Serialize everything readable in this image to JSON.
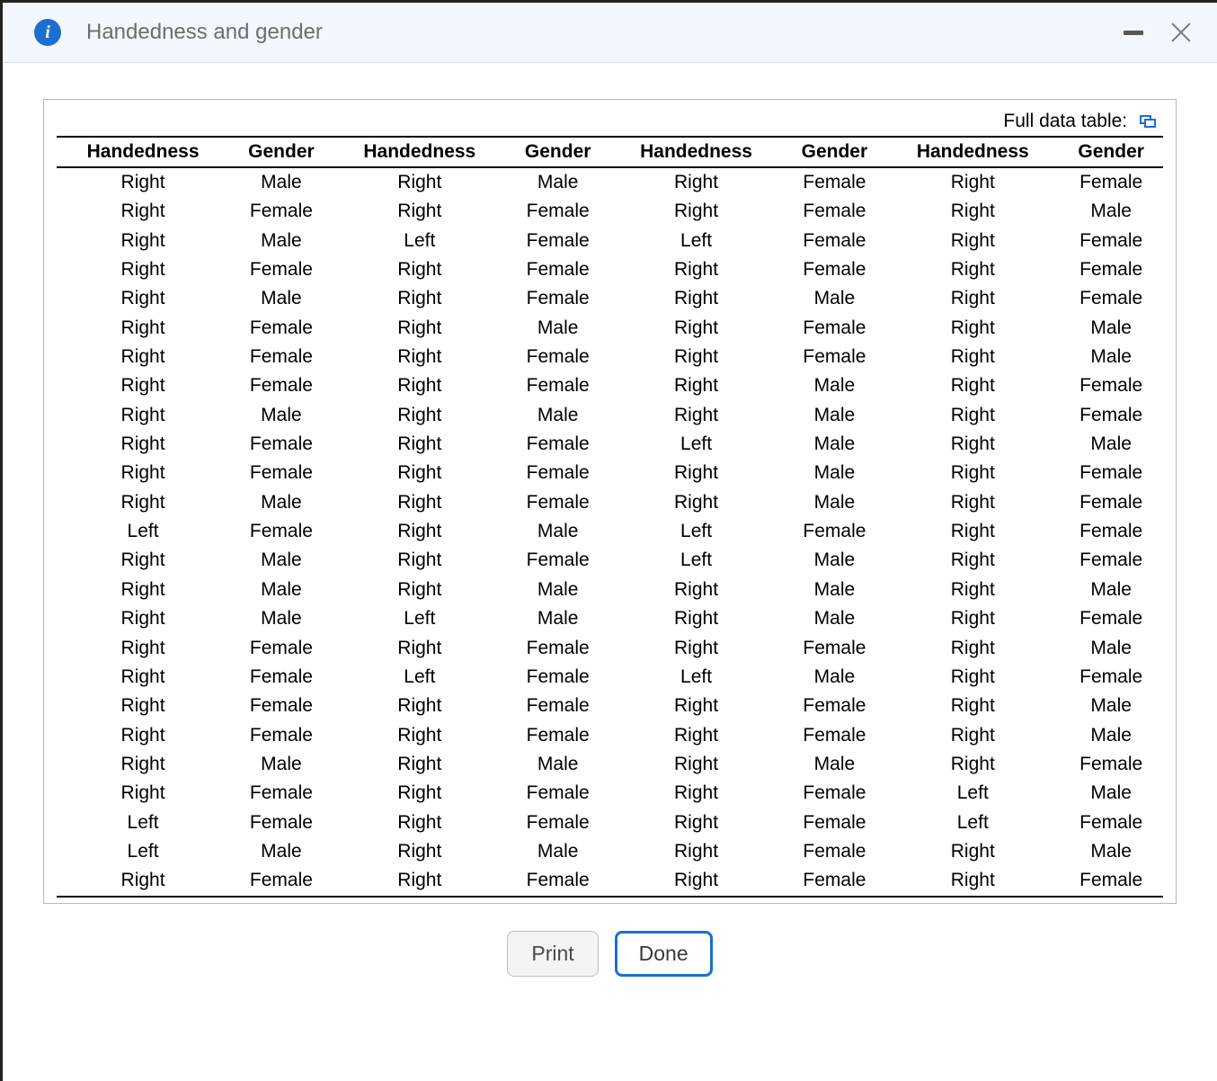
{
  "header": {
    "title": "Handedness and gender"
  },
  "caption_label": "Full data table:",
  "columns": [
    "Handedness",
    "Gender",
    "Handedness",
    "Gender",
    "Handedness",
    "Gender",
    "Handedness",
    "Gender"
  ],
  "rows": [
    [
      "Right",
      "Male",
      "Right",
      "Male",
      "Right",
      "Female",
      "Right",
      "Female"
    ],
    [
      "Right",
      "Female",
      "Right",
      "Female",
      "Right",
      "Female",
      "Right",
      "Male"
    ],
    [
      "Right",
      "Male",
      "Left",
      "Female",
      "Left",
      "Female",
      "Right",
      "Female"
    ],
    [
      "Right",
      "Female",
      "Right",
      "Female",
      "Right",
      "Female",
      "Right",
      "Female"
    ],
    [
      "Right",
      "Male",
      "Right",
      "Female",
      "Right",
      "Male",
      "Right",
      "Female"
    ],
    [
      "Right",
      "Female",
      "Right",
      "Male",
      "Right",
      "Female",
      "Right",
      "Male"
    ],
    [
      "Right",
      "Female",
      "Right",
      "Female",
      "Right",
      "Female",
      "Right",
      "Male"
    ],
    [
      "Right",
      "Female",
      "Right",
      "Female",
      "Right",
      "Male",
      "Right",
      "Female"
    ],
    [
      "Right",
      "Male",
      "Right",
      "Male",
      "Right",
      "Male",
      "Right",
      "Female"
    ],
    [
      "Right",
      "Female",
      "Right",
      "Female",
      "Left",
      "Male",
      "Right",
      "Male"
    ],
    [
      "Right",
      "Female",
      "Right",
      "Female",
      "Right",
      "Male",
      "Right",
      "Female"
    ],
    [
      "Right",
      "Male",
      "Right",
      "Female",
      "Right",
      "Male",
      "Right",
      "Female"
    ],
    [
      "Left",
      "Female",
      "Right",
      "Male",
      "Left",
      "Female",
      "Right",
      "Female"
    ],
    [
      "Right",
      "Male",
      "Right",
      "Female",
      "Left",
      "Male",
      "Right",
      "Female"
    ],
    [
      "Right",
      "Male",
      "Right",
      "Male",
      "Right",
      "Male",
      "Right",
      "Male"
    ],
    [
      "Right",
      "Male",
      "Left",
      "Male",
      "Right",
      "Male",
      "Right",
      "Female"
    ],
    [
      "Right",
      "Female",
      "Right",
      "Female",
      "Right",
      "Female",
      "Right",
      "Male"
    ],
    [
      "Right",
      "Female",
      "Left",
      "Female",
      "Left",
      "Male",
      "Right",
      "Female"
    ],
    [
      "Right",
      "Female",
      "Right",
      "Female",
      "Right",
      "Female",
      "Right",
      "Male"
    ],
    [
      "Right",
      "Female",
      "Right",
      "Female",
      "Right",
      "Female",
      "Right",
      "Male"
    ],
    [
      "Right",
      "Male",
      "Right",
      "Male",
      "Right",
      "Male",
      "Right",
      "Female"
    ],
    [
      "Right",
      "Female",
      "Right",
      "Female",
      "Right",
      "Female",
      "Left",
      "Male"
    ],
    [
      "Left",
      "Female",
      "Right",
      "Female",
      "Right",
      "Female",
      "Left",
      "Female"
    ],
    [
      "Left",
      "Male",
      "Right",
      "Male",
      "Right",
      "Female",
      "Right",
      "Male"
    ],
    [
      "Right",
      "Female",
      "Right",
      "Female",
      "Right",
      "Female",
      "Right",
      "Female"
    ]
  ],
  "buttons": {
    "print": "Print",
    "done": "Done"
  }
}
